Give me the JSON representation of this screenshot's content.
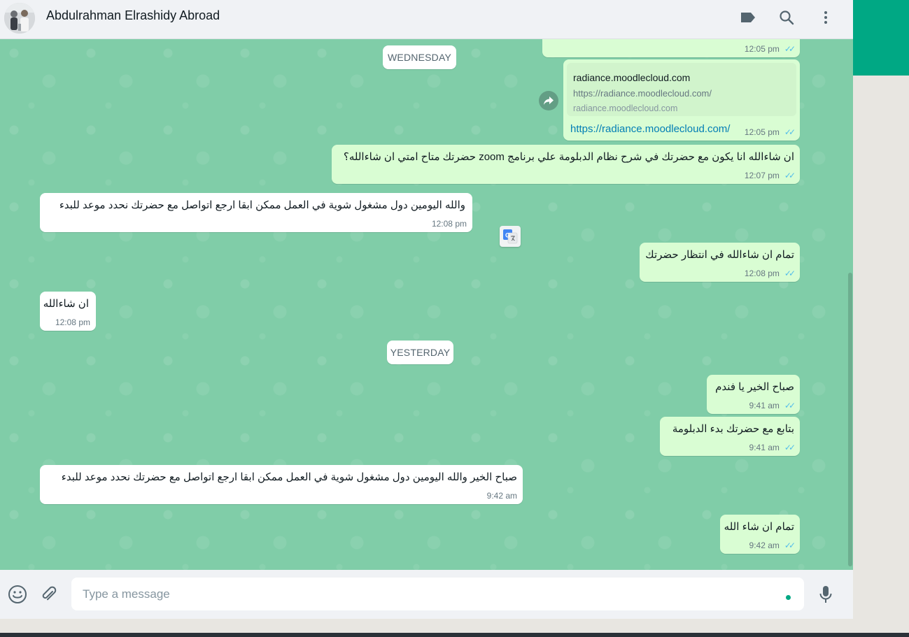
{
  "header": {
    "contact_name": "Abdulrahman Elrashidy Abroad"
  },
  "chat": {
    "day_separators": [
      "WEDNESDAY",
      "YESTERDAY"
    ],
    "messages": [
      {
        "dir": "out",
        "text": "",
        "time": "12:05 pm"
      },
      {
        "dir": "out",
        "link_preview": {
          "title": "radiance.moodlecloud.com",
          "description": "https://radiance.moodlecloud.com/",
          "domain": "radiance.moodlecloud.com"
        },
        "text": "https://radiance.moodlecloud.com/",
        "time": "12:05 pm"
      },
      {
        "dir": "out",
        "text": "ان شاءالله انا يكون مع حضرتك في شرح نظام  الدبلومة علي برنامج zoom حضرتك متاح امتي ان شاءالله؟",
        "time": "12:07 pm"
      },
      {
        "dir": "in",
        "text": "والله اليومين دول مشغول شوية في العمل ممكن ابقا ارجع اتواصل مع حضرتك نحدد موعد للبدء",
        "time": "12:08 pm"
      },
      {
        "dir": "out",
        "text": "تمام ان شاءالله في انتظار حضرتك",
        "time": "12:08 pm"
      },
      {
        "dir": "in",
        "text": "ان شاءالله",
        "time": "12:08 pm"
      },
      {
        "dir": "out",
        "text": "صباح الخير يا فندم",
        "time": "9:41 am"
      },
      {
        "dir": "out",
        "text": "بتابع مع حضرتك بدء الدبلومة",
        "time": "9:41 am"
      },
      {
        "dir": "in",
        "text": "صباح الخير والله اليومين دول مشغول شوية في العمل ممكن ابقا ارجع اتواصل مع حضرتك نحدد موعد للبدء",
        "time": "9:42 am"
      },
      {
        "dir": "out",
        "text": "تمام ان شاء الله",
        "time": "9:42 am"
      }
    ]
  },
  "composer": {
    "placeholder": "Type a message"
  },
  "icons": {
    "header": [
      "label-icon",
      "search-icon",
      "menu-icon"
    ],
    "composer": [
      "emoji-icon",
      "attach-icon",
      "mic-icon"
    ],
    "chat": [
      "forward-icon",
      "google-translate-icon",
      "read-receipt-icon"
    ]
  },
  "colors": {
    "chat_background": "#80cda8",
    "outgoing_bubble": "#d9fdd3",
    "incoming_bubble": "#ffffff",
    "accent": "#00a884",
    "read_tick": "#53bdeb",
    "link": "#027eb5"
  }
}
